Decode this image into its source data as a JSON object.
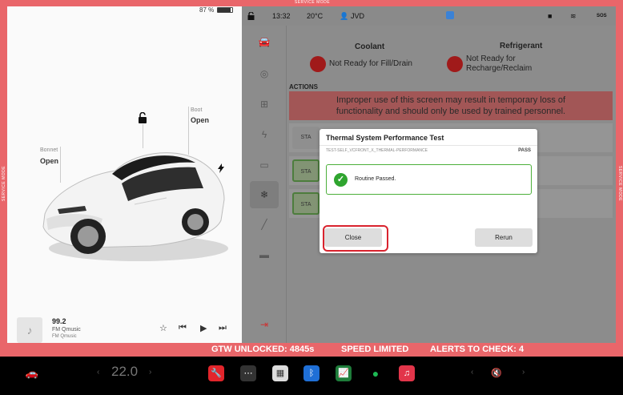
{
  "service_mode": {
    "top_label": "SERVICE MODE",
    "side_label": "SERVICE MODE"
  },
  "left_panel": {
    "battery_percent": "87 %",
    "battery_level": 0.87,
    "boot": {
      "label": "Boot",
      "value": "Open"
    },
    "bonnet": {
      "label": "Bonnet",
      "value": "Open"
    },
    "media": {
      "station": "99.2",
      "source": "FM Qmusic",
      "sub": "FM Qmusic"
    }
  },
  "status_bar": {
    "time": "13:32",
    "temperature": "20°C",
    "user": "JVD",
    "sos": "SOS"
  },
  "sidebar": {
    "icons": [
      "car-icon",
      "steering-wheel-icon",
      "chip-icon",
      "lightning-icon",
      "battery-icon",
      "snowflake-icon",
      "brush-icon",
      "folder-icon",
      "exit-icon"
    ]
  },
  "thermal": {
    "coolant": {
      "title": "Coolant",
      "status": "Not Ready for Fill/Drain"
    },
    "refrigerant": {
      "title": "Refrigerant",
      "status_line1": "Not Ready for",
      "status_line2": "Recharge/Reclaim"
    },
    "actions_title": "ACTIONS",
    "warning_line1": "Improper use of this screen may result in temporary loss of",
    "warning_line2": "functionality and should only be used by trained personnel.",
    "start_label": "STA"
  },
  "modal": {
    "title": "Thermal System Performance Test",
    "test_id": "TEST-SELF_VCFRONT_X_THERMAL-PERFORMANCE",
    "result": "PASS",
    "message": "Routine Passed.",
    "close_label": "Close",
    "rerun_label": "Rerun"
  },
  "alert_bar": {
    "gtw": "GTW UNLOCKED: 4845s",
    "speed": "SPEED LIMITED",
    "alerts": "ALERTS TO CHECK: 4"
  },
  "taskbar": {
    "temperature": "22.0"
  },
  "colors": {
    "service_red": "#e9666a",
    "status_red": "#a01a1a",
    "pass_green": "#2fa52f",
    "highlight_red": "#d9232e"
  }
}
